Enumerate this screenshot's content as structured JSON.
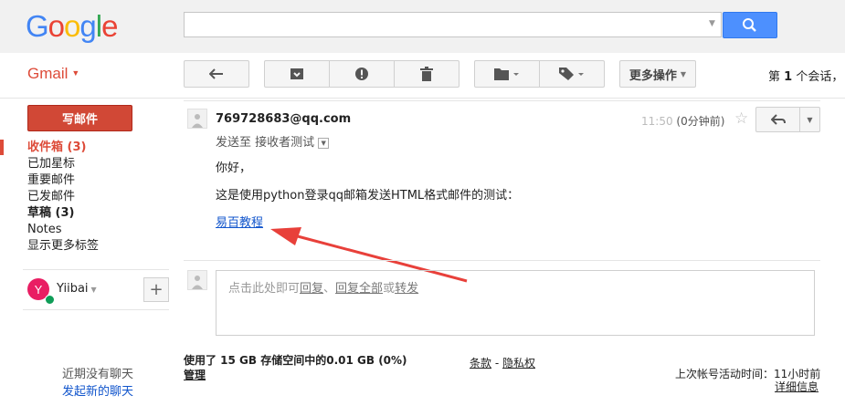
{
  "header": {
    "logo_letters": [
      {
        "ch": "G",
        "color": "#4285f4"
      },
      {
        "ch": "o",
        "color": "#ea4335"
      },
      {
        "ch": "o",
        "color": "#fbbc05"
      },
      {
        "ch": "g",
        "color": "#4285f4"
      },
      {
        "ch": "l",
        "color": "#34a853"
      },
      {
        "ch": "e",
        "color": "#ea4335"
      }
    ],
    "search_value": "",
    "search_icon": "magnifier-icon"
  },
  "app": {
    "name": "Gmail"
  },
  "toolbar": {
    "buttons": [
      "back-arrow-icon",
      "archive-icon",
      "report-spam-icon",
      "trash-icon",
      "folder-icon",
      "label-tag-icon"
    ],
    "more_actions": "更多操作",
    "pager_prefix": "第",
    "pager_count": "1",
    "pager_suffix": "个会话，"
  },
  "sidebar": {
    "compose": "写邮件",
    "items": [
      {
        "label": "收件箱 (3)"
      },
      {
        "label": "已加星标"
      },
      {
        "label": "重要邮件"
      },
      {
        "label": "已发邮件"
      },
      {
        "label": "草稿 (3)"
      },
      {
        "label": "Notes"
      },
      {
        "label": "显示更多标签"
      }
    ],
    "user": {
      "initial": "Y",
      "name": "Yiibai",
      "avatar_color": "#e91e63",
      "status_color": "#0f9d58"
    },
    "chat": {
      "empty": "近期没有聊天",
      "start": "发起新的聊天"
    }
  },
  "message": {
    "sender": "769728683@qq.com",
    "sent_to": "发送至 接收者测试",
    "time_partial": "11:50",
    "time_relative": "(0分钟前)",
    "greeting": "你好，",
    "body": "这是使用python登录qq邮箱发送HTML格式邮件的测试：",
    "link": "易百教程",
    "annotation_arrow_color": "#e8403a"
  },
  "reply": {
    "prompt_pre": "点击此处即可",
    "reply": "回复",
    "sep": "、",
    "reply_all": "回复全部",
    "or": "或",
    "forward": "转发"
  },
  "footer": {
    "storage": "使用了 15 GB 存储空间中的0.01 GB (0%)",
    "manage": "管理",
    "terms": "条款",
    "terms_sep": " - ",
    "privacy": "隐私权",
    "last_activity": "上次帐号活动时间：11小时前",
    "details": "详细信息"
  }
}
